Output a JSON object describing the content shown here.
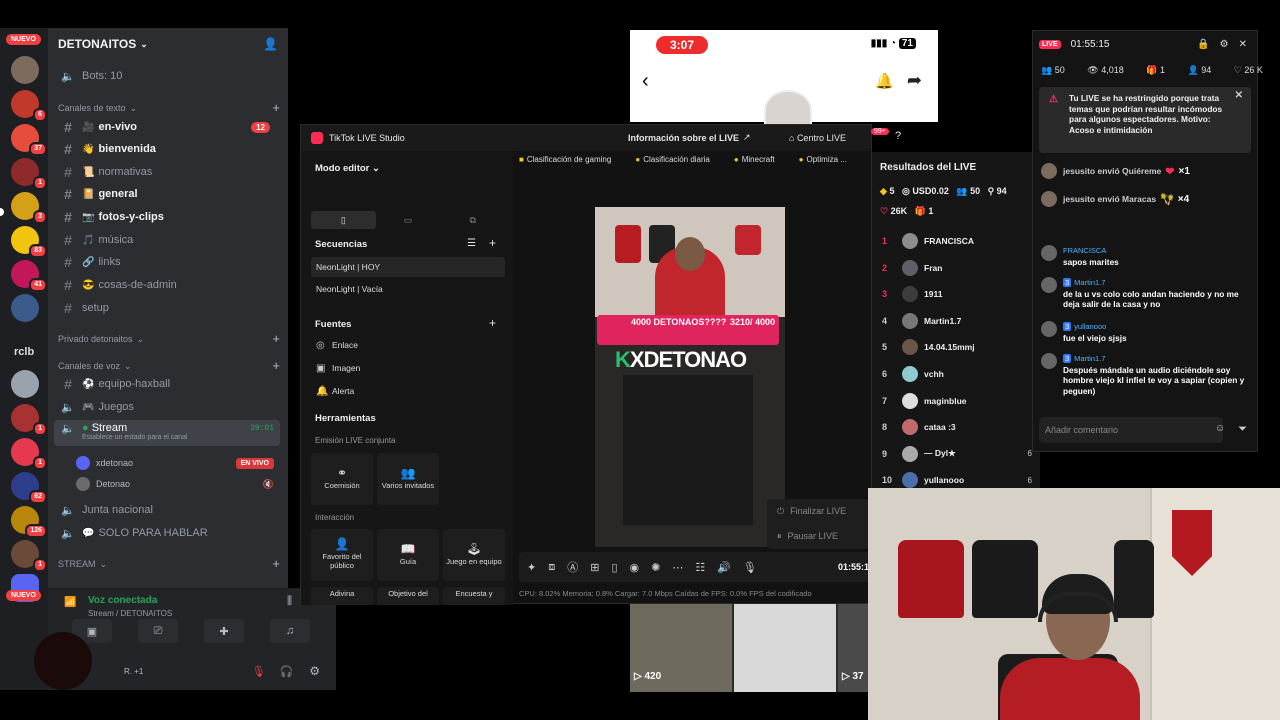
{
  "discord": {
    "nuevo_badge": "NUEVO",
    "server_name": "DETONAITOS",
    "rail_label": "rclb",
    "server_badges": [
      "6",
      "37",
      "1",
      "3",
      "83",
      "41",
      "1",
      "1",
      "62",
      "126",
      "1"
    ],
    "bots_channel": "Bots: 10",
    "categories": {
      "text": "Canales de texto",
      "private": "Privado detonaitos",
      "voice": "Canales de voz",
      "stream": "STREAM"
    },
    "text_channels": [
      {
        "label": "en-vivo",
        "emoji": "🎥",
        "badge": "12"
      },
      {
        "label": "bienvenida",
        "emoji": "👋",
        "badge": ""
      },
      {
        "label": "normativas",
        "emoji": "📜",
        "badge": ""
      },
      {
        "label": "general",
        "emoji": "📔",
        "badge": ""
      },
      {
        "label": "fotos-y-clips",
        "emoji": "📷",
        "badge": ""
      },
      {
        "label": "música",
        "emoji": "🎵",
        "badge": ""
      },
      {
        "label": "links",
        "emoji": "🔗",
        "badge": ""
      },
      {
        "label": "cosas-de-admin",
        "emoji": "😎",
        "badge": ""
      },
      {
        "label": "setup",
        "emoji": "",
        "badge": ""
      }
    ],
    "voice_channels": [
      {
        "label": "equipo-haxball",
        "emoji": "⚽"
      },
      {
        "label": "Juegos",
        "emoji": "🎮"
      }
    ],
    "stream_channel": {
      "label": "Stream",
      "time": "39:01",
      "status": "Establece un estado para el canal"
    },
    "voice_users": [
      {
        "name": "xdetonao",
        "live": "EN VIVO"
      },
      {
        "name": "Detonao",
        "live": ""
      }
    ],
    "more_channels": [
      {
        "label": "Junta nacional",
        "emoji": ""
      },
      {
        "label": "SOLO PARA HABLAR",
        "emoji": "💬"
      }
    ],
    "voice_status": "Voz conectada",
    "voice_sub": "Stream / DETONAITOS",
    "user_suffix": "R. +1"
  },
  "phone": {
    "time": "3:07",
    "battery": "71"
  },
  "studio": {
    "app_title": "TikTok LIVE Studio",
    "info_link": "Información sobre el LIVE",
    "center_link": "Centro LIVE",
    "notif_badge": "99+",
    "mode_label": "Modo editor",
    "sequences_title": "Secuencias",
    "sequences": [
      "NeonLight | HOY",
      "NeonLight | Vacía"
    ],
    "sources_title": "Fuentes",
    "sources": [
      {
        "label": "Enlace",
        "icon": "globe-icon"
      },
      {
        "label": "Imagen",
        "icon": "image-icon"
      },
      {
        "label": "Alerta",
        "icon": "bell-icon"
      }
    ],
    "tools_title": "Herramientas",
    "joint_title": "Emisión LIVE conjunta",
    "joint_tiles": [
      "Coemisión",
      "Varios invitados"
    ],
    "interaction_title": "Interacción",
    "interaction_tiles": [
      "Favorito del público",
      "Guía",
      "Juego en equipo"
    ],
    "bottom_tiles": [
      "Adivina",
      "Objetivo del",
      "Encuesta y"
    ],
    "chips": [
      "Clasificación de gaming",
      "Clasificación diaria",
      "Minecraft",
      "Optimiza ..."
    ],
    "goal_text": "4000 DETONAOS????",
    "goal_progress": "3210/ 4000",
    "preview_name_k": "K",
    "preview_name": "XDETONAO",
    "menu_end": "Finalizar LIVE",
    "menu_pause": "Pausar LIVE",
    "timer": "01:55:1",
    "stats": "CPU: 8.02%     Memoria: 0.8%     Cargar: 7.0 Mbps     Caídas de FPS: 0.0%     FPS del codificado"
  },
  "results": {
    "title": "Resultados del LIVE",
    "diamonds": "5",
    "usd": "USD0.02",
    "viewers": "50",
    "shares": "94",
    "likes": "26K",
    "gifts": "1",
    "ranking": [
      {
        "rank": "1",
        "name": "FRANCISCA",
        "score": ""
      },
      {
        "rank": "2",
        "name": "Fran",
        "score": ""
      },
      {
        "rank": "3",
        "name": "1911",
        "score": ""
      },
      {
        "rank": "4",
        "name": "Martin1.7",
        "score": ""
      },
      {
        "rank": "5",
        "name": "14.04.15mmj",
        "score": ""
      },
      {
        "rank": "6",
        "name": "vchh",
        "score": ""
      },
      {
        "rank": "7",
        "name": "maginblue",
        "score": ""
      },
      {
        "rank": "8",
        "name": "cataa :3",
        "score": ""
      },
      {
        "rank": "9",
        "name": "— Dyl★",
        "score": "6"
      },
      {
        "rank": "10",
        "name": "yullanooo",
        "score": "6"
      }
    ]
  },
  "chat": {
    "live_pill": "LIVE",
    "duration": "01:55:15",
    "viewers": "50",
    "total_views": "4,018",
    "gifts": "1",
    "members": "94",
    "likes": "26 K",
    "alert": "Tu LIVE se ha restringido porque trata temas que podrían resultar incómodos para algunos espectadores. Motivo: Acoso e intimidación",
    "gift_events": [
      {
        "user": "jesusito",
        "text": "envió Quiéreme",
        "count": "×1",
        "icon": "❤"
      },
      {
        "user": "jesusito",
        "text": "envió Maracas",
        "count": "×4",
        "icon": "🪇"
      }
    ],
    "messages": [
      {
        "user": "FRANCISCA",
        "level": "",
        "body": "sapos marites"
      },
      {
        "user": "Martin1.7",
        "level": "3",
        "body": "de la u vs colo colo andan haciendo y no me deja salir de la casa y no"
      },
      {
        "user": "yullanooo",
        "level": "3",
        "body": "fue el viejo sjsjs"
      },
      {
        "user": "Martin1.7",
        "level": "3",
        "body": "Después mándale un audio diciéndole soy hombre viejo kl infiel te voy a sapiar (copien y peguen)"
      }
    ],
    "input_placeholder": "Añadir comentario"
  },
  "thumbs": {
    "counts": [
      "420",
      "37"
    ]
  },
  "colors": {
    "discord_bg": "#2b2d31",
    "tiktok_pink": "#fe2c55",
    "live_green": "#23a55a"
  }
}
